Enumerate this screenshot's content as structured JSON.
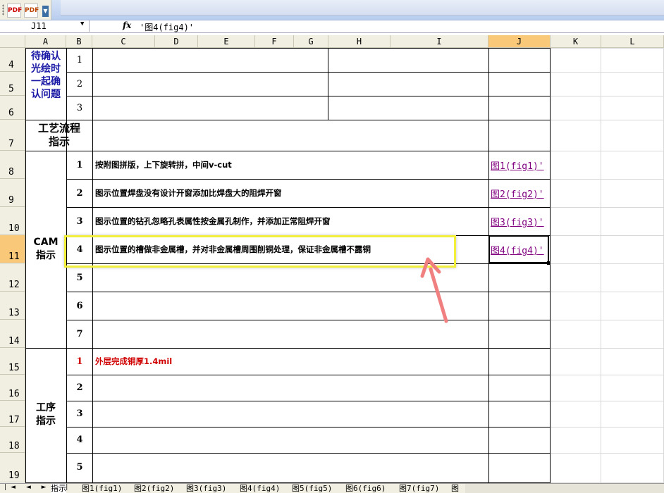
{
  "namebox": "J11",
  "formula_fx": "fx",
  "formula_value": "'图4(fig4)'",
  "columns": [
    "A",
    "B",
    "C",
    "D",
    "E",
    "F",
    "G",
    "H",
    "I",
    "J",
    "K",
    "L"
  ],
  "rows": [
    "4",
    "5",
    "6",
    "7",
    "8",
    "9",
    "10",
    "11",
    "12",
    "13",
    "14",
    "15",
    "16",
    "17",
    "18",
    "19"
  ],
  "confirm_label": "待确认\n光绘时\n一起确\n认问题",
  "confirm_nums": [
    "1",
    "2",
    "3"
  ],
  "process_label": "工艺流程\n指示",
  "cam_label": "CAM\n指示",
  "cam_nums": [
    "1",
    "2",
    "3",
    "4",
    "5",
    "6",
    "7"
  ],
  "cam_items": [
    "按附图拼版，上下旋转拼，中间v-cut",
    "图示位置焊盘没有设计开窗添加比焊盘大的阻焊开窗",
    "图示位置的钻孔忽略孔表属性按金属孔制作，并添加正常阻焊开窗",
    "图示位置的槽做非金属槽，并对非金属槽周围削铜处理，保证非金属槽不露铜"
  ],
  "cam_links": [
    "图1(fig1)'",
    "图2(fig2)'",
    "图3(fig3)'",
    "图4(fig4)'"
  ],
  "proc_label": "工序\n指示",
  "proc_nums": [
    "1",
    "2",
    "3",
    "4",
    "5"
  ],
  "proc_item1": "外层完成铜厚1.4mil",
  "tabs": [
    "指示",
    "图1(fig1)",
    "图2(fig2)",
    "图3(fig3)",
    "图4(fig4)",
    "图5(fig5)",
    "图6(fig6)",
    "图7(fig7)",
    "图"
  ],
  "tab_nav": "|◄ ◄ ► ►|",
  "toolbar_btn1": "PDF",
  "toolbar_btn2": "PDF",
  "colors": {
    "accent": "#f9c878",
    "link": "#800080",
    "red": "#d00000",
    "blue": "#1a1aa6",
    "highlight": "#f2ee3c",
    "arrow": "#f07f7f"
  }
}
